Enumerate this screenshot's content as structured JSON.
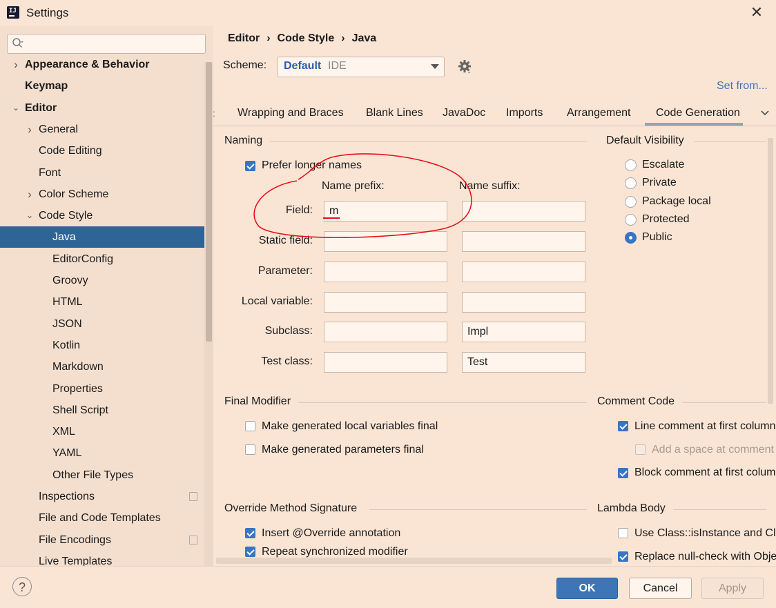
{
  "window": {
    "title": "Settings",
    "close_icon": "close-icon"
  },
  "sidebar": {
    "search_placeholder": "",
    "items": [
      {
        "label": "Appearance & Behavior",
        "level": 0,
        "bold": true,
        "expander": "collapsed"
      },
      {
        "label": "Keymap",
        "level": 0,
        "bold": true,
        "expander": "none"
      },
      {
        "label": "Editor",
        "level": 0,
        "bold": true,
        "expander": "expanded"
      },
      {
        "label": "General",
        "level": 1,
        "bold": false,
        "expander": "collapsed"
      },
      {
        "label": "Code Editing",
        "level": 1,
        "bold": false,
        "expander": "none"
      },
      {
        "label": "Font",
        "level": 1,
        "bold": false,
        "expander": "none"
      },
      {
        "label": "Color Scheme",
        "level": 1,
        "bold": false,
        "expander": "collapsed"
      },
      {
        "label": "Code Style",
        "level": 1,
        "bold": false,
        "expander": "expanded"
      },
      {
        "label": "Java",
        "level": 2,
        "bold": false,
        "expander": "none",
        "selected": true
      },
      {
        "label": "EditorConfig",
        "level": 2,
        "bold": false,
        "expander": "none"
      },
      {
        "label": "Groovy",
        "level": 2,
        "bold": false,
        "expander": "none"
      },
      {
        "label": "HTML",
        "level": 2,
        "bold": false,
        "expander": "none"
      },
      {
        "label": "JSON",
        "level": 2,
        "bold": false,
        "expander": "none"
      },
      {
        "label": "Kotlin",
        "level": 2,
        "bold": false,
        "expander": "none"
      },
      {
        "label": "Markdown",
        "level": 2,
        "bold": false,
        "expander": "none"
      },
      {
        "label": "Properties",
        "level": 2,
        "bold": false,
        "expander": "none"
      },
      {
        "label": "Shell Script",
        "level": 2,
        "bold": false,
        "expander": "none"
      },
      {
        "label": "XML",
        "level": 2,
        "bold": false,
        "expander": "none"
      },
      {
        "label": "YAML",
        "level": 2,
        "bold": false,
        "expander": "none"
      },
      {
        "label": "Other File Types",
        "level": 2,
        "bold": false,
        "expander": "none"
      },
      {
        "label": "Inspections",
        "level": 1,
        "bold": false,
        "expander": "none",
        "copy_icon": true
      },
      {
        "label": "File and Code Templates",
        "level": 1,
        "bold": false,
        "expander": "none"
      },
      {
        "label": "File Encodings",
        "level": 1,
        "bold": false,
        "expander": "none",
        "copy_icon": true
      },
      {
        "label": "Live Templates",
        "level": 1,
        "bold": false,
        "expander": "none"
      }
    ]
  },
  "breadcrumb": [
    "Editor",
    "Code Style",
    "Java"
  ],
  "scheme": {
    "label": "Scheme:",
    "value": "Default",
    "sub": "IDE"
  },
  "set_from": "Set from...",
  "tabs": [
    {
      "label": "Wrapping and Braces"
    },
    {
      "label": "Blank Lines"
    },
    {
      "label": "JavaDoc"
    },
    {
      "label": "Imports"
    },
    {
      "label": "Arrangement"
    },
    {
      "label": "Code Generation",
      "active": true
    }
  ],
  "naming": {
    "title": "Naming",
    "prefer_longer": {
      "label": "Prefer longer names",
      "checked": true
    },
    "prefix_header": "Name prefix:",
    "suffix_header": "Name suffix:",
    "rows": [
      {
        "label": "Field:",
        "prefix": "m",
        "suffix": ""
      },
      {
        "label": "Static field:",
        "prefix": "",
        "suffix": ""
      },
      {
        "label": "Parameter:",
        "prefix": "",
        "suffix": ""
      },
      {
        "label": "Local variable:",
        "prefix": "",
        "suffix": ""
      },
      {
        "label": "Subclass:",
        "prefix": "",
        "suffix": "Impl"
      },
      {
        "label": "Test class:",
        "prefix": "",
        "suffix": "Test"
      }
    ]
  },
  "default_visibility": {
    "title": "Default Visibility",
    "options": [
      {
        "label": "Escalate",
        "checked": false
      },
      {
        "label": "Private",
        "checked": false
      },
      {
        "label": "Package local",
        "checked": false
      },
      {
        "label": "Protected",
        "checked": false
      },
      {
        "label": "Public",
        "checked": true
      }
    ]
  },
  "final_modifier": {
    "title": "Final Modifier",
    "items": [
      {
        "label": "Make generated local variables final",
        "checked": false
      },
      {
        "label": "Make generated parameters final",
        "checked": false
      }
    ]
  },
  "comment_code": {
    "title": "Comment Code",
    "items": [
      {
        "label": "Line comment at first column",
        "checked": true
      },
      {
        "label": "Add a space at comment start",
        "checked": false,
        "disabled": true
      },
      {
        "label": "Block comment at first column",
        "checked": true
      }
    ]
  },
  "override_sig": {
    "title": "Override Method Signature",
    "items": [
      {
        "label": "Insert @Override annotation",
        "checked": true
      },
      {
        "label": "Repeat synchronized modifier",
        "checked": true
      }
    ]
  },
  "lambda_body": {
    "title": "Lambda Body",
    "items": [
      {
        "label": "Use Class::isInstance and Class::cast",
        "checked": false
      },
      {
        "label": "Replace null-check with Objects::nonNull",
        "checked": true
      }
    ]
  },
  "buttons": {
    "ok": "OK",
    "cancel": "Cancel",
    "apply": "Apply",
    "help": "?"
  },
  "colors": {
    "selection": "#2f6496",
    "accent": "#3875c4",
    "annotation": "#e8101a"
  }
}
